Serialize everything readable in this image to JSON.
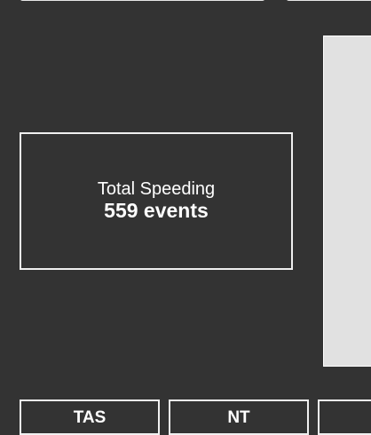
{
  "top_inputs": [
    {
      "value": ""
    },
    {
      "value": ""
    }
  ],
  "metric": {
    "label": "Total Speeding",
    "value": "559 events"
  },
  "regions": [
    {
      "label": "TAS"
    },
    {
      "label": "NT"
    },
    {
      "label": ""
    }
  ],
  "colors": {
    "background": "#333333",
    "card_border": "#f0f0f0",
    "panel": "#e1e1e1",
    "text": "#ffffff"
  }
}
